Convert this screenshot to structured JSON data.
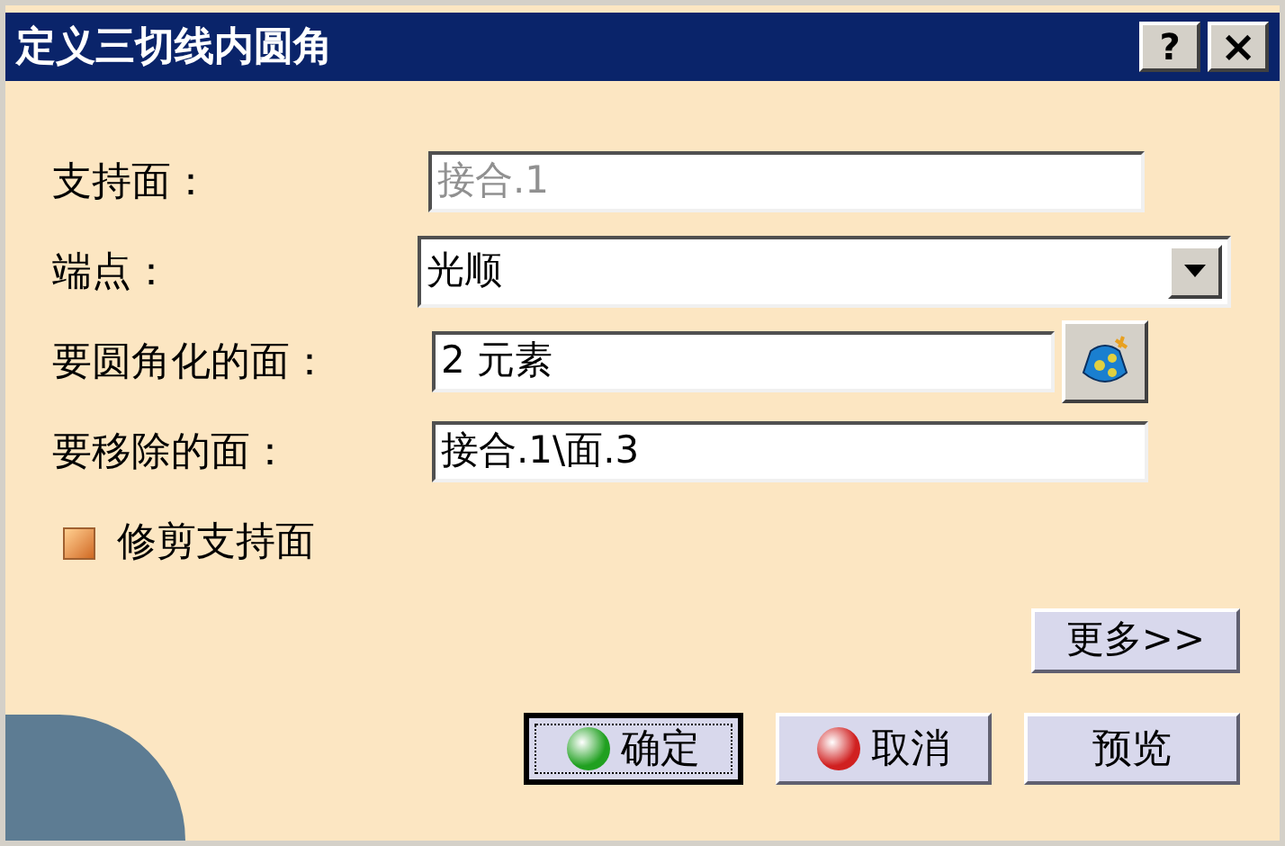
{
  "window": {
    "title": "定义三切线内圆角",
    "help": "?",
    "close": "×"
  },
  "fields": [
    {
      "kind": "text",
      "label": "支持面：",
      "value": "接合.1",
      "disabled": true
    },
    {
      "kind": "dropdown",
      "label": "端点：",
      "value": "光顺",
      "disabled": false
    },
    {
      "kind": "picker",
      "label": "要圆角化的面：",
      "value": "2 元素",
      "disabled": false
    },
    {
      "kind": "text",
      "label": "要移除的面：",
      "value": "接合.1\\面.3",
      "disabled": false
    }
  ],
  "trim_support": {
    "label": "修剪支持面",
    "checked": true
  },
  "more_button": "更多>>",
  "buttons": [
    {
      "kind": "ok",
      "label": "确定",
      "focused": true
    },
    {
      "kind": "cancel",
      "label": "取消",
      "focused": false
    },
    {
      "kind": "plain",
      "label": "预览",
      "focused": false
    }
  ]
}
